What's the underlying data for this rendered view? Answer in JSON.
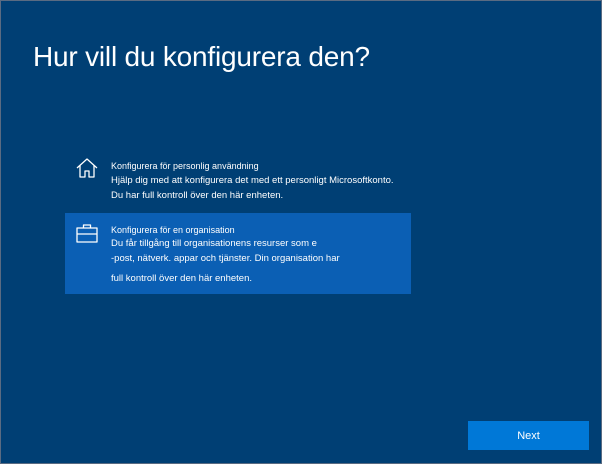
{
  "page": {
    "title": "Hur vill du konfigurera den?"
  },
  "options": [
    {
      "icon": "home-icon",
      "title": "Konfigurera för personlig användning",
      "description_lines": [
        "Hjälp dig med att konfigurera det med ett personligt Microsoftkonto.",
        "Du har full kontroll över den här enheten."
      ],
      "selected": false
    },
    {
      "icon": "briefcase-icon",
      "title": "Konfigurera för en organisation",
      "description_lines": [
        "Du får tillgång till organisationens resurser som e",
        "-post, nätverk. appar och tjänster. Din organisation har",
        "full kontroll över den här enheten."
      ],
      "selected": true
    }
  ],
  "footer": {
    "next_label": "Next"
  },
  "colors": {
    "background": "#003f74",
    "selected_option": "#0b5fb4",
    "next_button": "#0078d7",
    "text": "#ffffff"
  }
}
